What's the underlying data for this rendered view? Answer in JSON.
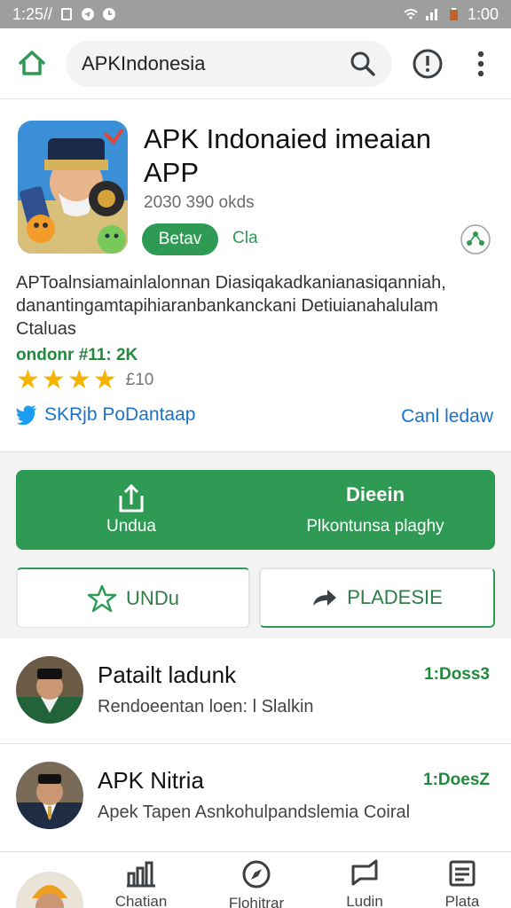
{
  "status_bar": {
    "time_left": "1:25//",
    "time_right": "1:00"
  },
  "search": {
    "query": "APKIndonesia"
  },
  "app": {
    "title": "APK Indonaied imeaian APP",
    "meta": "2030 390 okds",
    "pill_label": "Betav",
    "pill_side": "Cla",
    "description": "APToalnsiamainlalonnan Diasiqakadkanianasiqanniah, danantingamtapihiaranbankanckani Detiuianahalulam Ctaluas",
    "stat": "ondonr #11: 2K",
    "rating_count": "£10",
    "twitter_text": "SKRjb PoDantaap",
    "cancel_label": "Canl ledaw"
  },
  "main_action": {
    "left_label": "Undua",
    "right_title": "Dieein",
    "right_sub": "Plkontunsa plaghy"
  },
  "buttons": {
    "undu": "UNDu",
    "pladesie": "PLADESIE"
  },
  "list": [
    {
      "title": "Patailt ladunk",
      "subtitle": "Rendoeentan loen: l Slalkin",
      "meta": "1:Doss3"
    },
    {
      "title": "APK Nitria",
      "subtitle": "Apek Tapen Asnkohulpandslemia Coiral",
      "meta": "1:DoesZ"
    }
  ],
  "bottom_nav": [
    {
      "label": "Chatian",
      "icon": "home-chart-icon"
    },
    {
      "label": "Flohitrar",
      "icon": "compass-icon"
    },
    {
      "label": "Ludin",
      "icon": "chat-icon"
    },
    {
      "label": "Plata",
      "icon": "list-icon"
    }
  ],
  "colors": {
    "primary": "#2e9a53",
    "link": "#1a73c8",
    "star": "#f5b400"
  }
}
